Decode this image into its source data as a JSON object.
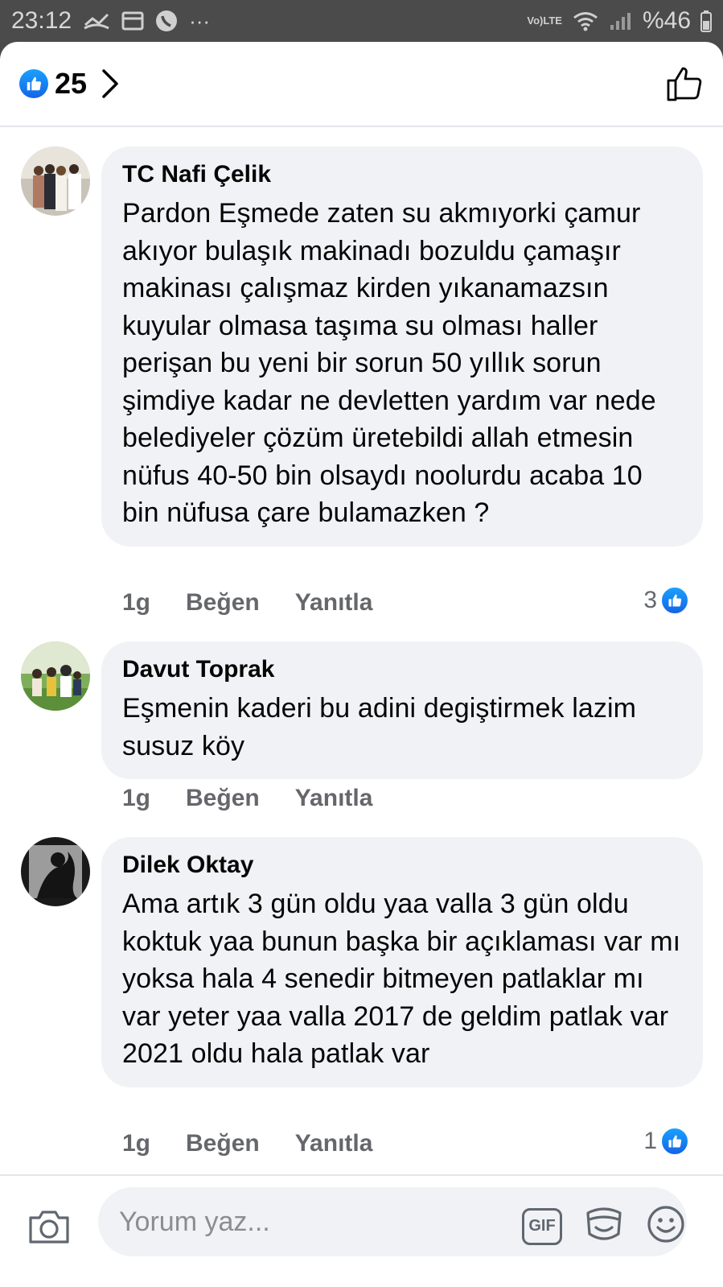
{
  "status_bar": {
    "time": "23:12",
    "more": "···",
    "network_top": "Vo)",
    "network_bottom": "LTE",
    "battery": "%46"
  },
  "header": {
    "reaction_count": "25"
  },
  "comments": [
    {
      "author": "TC Nafi Çelik",
      "text": "Pardon Eşmede zaten su akmıyorki çamur akıyor bulaşık makinadı bozuldu çamaşır makinası çalışmaz kirden yıkanamazsın kuyular olmasa taşıma su olması haller perişan bu yeni bir sorun 50 yıllık sorun şimdiye kadar ne devletten yardım var nede belediyeler çözüm üretebildi allah etmesin nüfus 40-50  bin olsaydı noolurdu  acaba 10 bin nüfusa çare bulamazken ?",
      "time": "1g",
      "like_label": "Beğen",
      "reply_label": "Yanıtla",
      "reaction_count": "3"
    },
    {
      "author": "Davut Toprak",
      "text": "Eşmenin kaderi bu adini degiştirmek lazim susuz köy",
      "time": "1g",
      "like_label": "Beğen",
      "reply_label": "Yanıtla",
      "reaction_count": ""
    },
    {
      "author": "Dilek Oktay",
      "text": "Ama artık 3 gün oldu yaa valla 3 gün oldu koktuk yaa bunun başka bir açıklaması var mı yoksa hala 4 senedir bitmeyen patlaklar mı var  yeter yaa valla 2017 de geldim patlak var 2021 oldu hala patlak var",
      "time": "1g",
      "like_label": "Beğen",
      "reply_label": "Yanıtla",
      "reaction_count": "1"
    }
  ],
  "composer": {
    "placeholder": "Yorum yaz...",
    "gif_label": "GIF"
  },
  "colors": {
    "like_blue": "#1877f2",
    "bubble": "#f0f2f5",
    "meta_text": "#65676b"
  }
}
